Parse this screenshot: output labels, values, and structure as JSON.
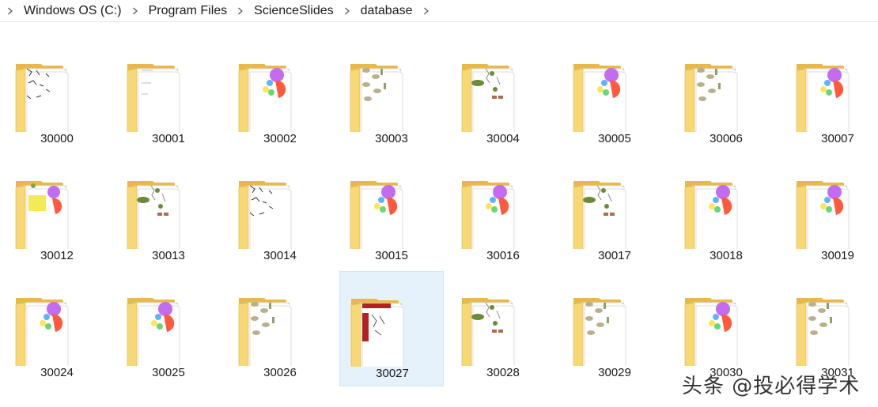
{
  "breadcrumb": {
    "items": [
      {
        "label": "Windows OS (C:)",
        "name": "breadcrumb-item-windows-os"
      },
      {
        "label": "Program Files",
        "name": "breadcrumb-item-program-files"
      },
      {
        "label": "ScienceSlides",
        "name": "breadcrumb-item-scienceslides"
      },
      {
        "label": "database",
        "name": "breadcrumb-item-database"
      }
    ]
  },
  "folders": [
    {
      "name": "30000",
      "thumb": "sketch"
    },
    {
      "name": "30001",
      "thumb": "blank"
    },
    {
      "name": "30002",
      "thumb": "pie"
    },
    {
      "name": "30003",
      "thumb": "cells"
    },
    {
      "name": "30004",
      "thumb": "molecule"
    },
    {
      "name": "30005",
      "thumb": "pie"
    },
    {
      "name": "30006",
      "thumb": "cells"
    },
    {
      "name": "30007",
      "thumb": "pie"
    },
    {
      "name": "30012",
      "thumb": "yellow"
    },
    {
      "name": "30013",
      "thumb": "molecule"
    },
    {
      "name": "30014",
      "thumb": "sketch"
    },
    {
      "name": "30015",
      "thumb": "pie"
    },
    {
      "name": "30016",
      "thumb": "pie"
    },
    {
      "name": "30017",
      "thumb": "molecule"
    },
    {
      "name": "30018",
      "thumb": "pie"
    },
    {
      "name": "30019",
      "thumb": "pie"
    },
    {
      "name": "30024",
      "thumb": "pie"
    },
    {
      "name": "30025",
      "thumb": "pie"
    },
    {
      "name": "30026",
      "thumb": "cells"
    },
    {
      "name": "30027",
      "thumb": "red"
    },
    {
      "name": "30028",
      "thumb": "molecule"
    },
    {
      "name": "30029",
      "thumb": "cells"
    },
    {
      "name": "30030",
      "thumb": "pie"
    },
    {
      "name": "30031",
      "thumb": "cells"
    }
  ],
  "selected_folder": "30027",
  "watermark": {
    "text": "头条 @投必得学术"
  },
  "colors": {
    "folder_back": "#e8b84a",
    "folder_front": "#f8d775",
    "selected_bg": "#e5f1fb",
    "selected_border": "#cce8ff"
  }
}
